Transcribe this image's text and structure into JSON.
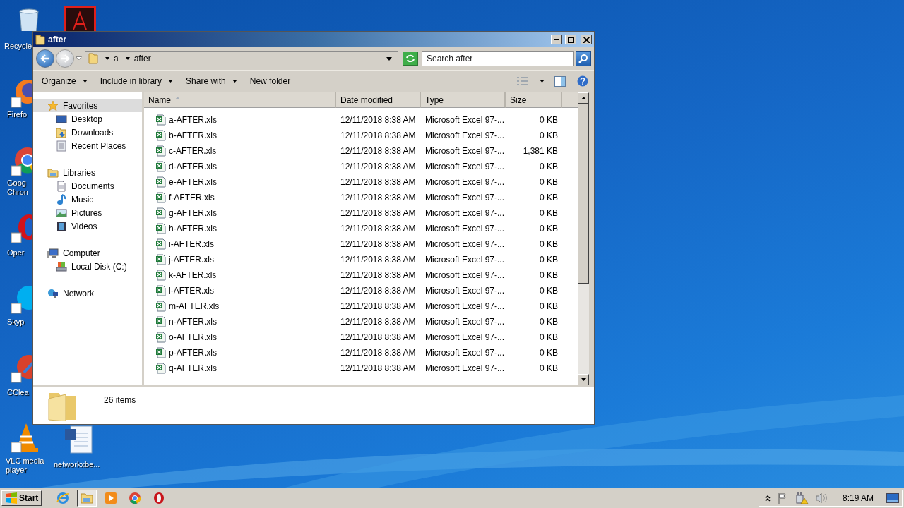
{
  "desktop_icons": [
    {
      "kind": "recycle",
      "lines": [
        "Recycle"
      ]
    },
    {
      "kind": "acrobat"
    },
    {
      "kind": "firefox",
      "lines": [
        "Firefo"
      ]
    },
    {
      "kind": "chrome",
      "lines": [
        "Goog",
        "Chron"
      ]
    },
    {
      "kind": "opera",
      "lines": [
        "Oper"
      ]
    },
    {
      "kind": "skype",
      "lines": [
        "Skyp"
      ]
    },
    {
      "kind": "ccleaner",
      "lines": [
        "CClea"
      ]
    },
    {
      "kind": "vlc",
      "lines": [
        "VLC media",
        "player"
      ]
    },
    {
      "kind": "word",
      "lines": [
        "networkxbe..."
      ]
    }
  ],
  "window": {
    "title": "after",
    "breadcrumb": [
      "a",
      "after"
    ],
    "search": {
      "placeholder": "Search after"
    },
    "commands": [
      {
        "label": "Organize",
        "dropdown": true
      },
      {
        "label": "Include in library",
        "dropdown": true
      },
      {
        "label": "Share with",
        "dropdown": true
      },
      {
        "label": "New folder",
        "dropdown": false
      }
    ],
    "nav": [
      {
        "label": "Favorites",
        "selected": true,
        "children": [
          {
            "label": "Desktop",
            "selected": false
          },
          {
            "label": "Downloads",
            "selected": false
          },
          {
            "label": "Recent Places",
            "selected": false
          }
        ]
      },
      {
        "label": "Libraries",
        "selected": false,
        "children": [
          {
            "label": "Documents",
            "selected": false
          },
          {
            "label": "Music",
            "selected": false
          },
          {
            "label": "Pictures",
            "selected": false
          },
          {
            "label": "Videos",
            "selected": false
          }
        ]
      },
      {
        "label": "Computer",
        "selected": false,
        "children": [
          {
            "label": "Local Disk (C:)",
            "selected": false
          }
        ]
      },
      {
        "label": "Network",
        "selected": false
      }
    ],
    "columns": [
      {
        "label": "Name",
        "sorted": true
      },
      {
        "label": "Date modified",
        "sorted": false
      },
      {
        "label": "Type",
        "sorted": false
      },
      {
        "label": "Size",
        "sorted": false
      }
    ],
    "rows": [
      {
        "name": "a-AFTER.xls",
        "date": "12/11/2018 8:38 AM",
        "type": "Microsoft Excel 97-...",
        "size": "0 KB"
      },
      {
        "name": "b-AFTER.xls",
        "date": "12/11/2018 8:38 AM",
        "type": "Microsoft Excel 97-...",
        "size": "0 KB"
      },
      {
        "name": "c-AFTER.xls",
        "date": "12/11/2018 8:38 AM",
        "type": "Microsoft Excel 97-...",
        "size": "1,381 KB"
      },
      {
        "name": "d-AFTER.xls",
        "date": "12/11/2018 8:38 AM",
        "type": "Microsoft Excel 97-...",
        "size": "0 KB"
      },
      {
        "name": "e-AFTER.xls",
        "date": "12/11/2018 8:38 AM",
        "type": "Microsoft Excel 97-...",
        "size": "0 KB"
      },
      {
        "name": "f-AFTER.xls",
        "date": "12/11/2018 8:38 AM",
        "type": "Microsoft Excel 97-...",
        "size": "0 KB"
      },
      {
        "name": "g-AFTER.xls",
        "date": "12/11/2018 8:38 AM",
        "type": "Microsoft Excel 97-...",
        "size": "0 KB"
      },
      {
        "name": "h-AFTER.xls",
        "date": "12/11/2018 8:38 AM",
        "type": "Microsoft Excel 97-...",
        "size": "0 KB"
      },
      {
        "name": "i-AFTER.xls",
        "date": "12/11/2018 8:38 AM",
        "type": "Microsoft Excel 97-...",
        "size": "0 KB"
      },
      {
        "name": "j-AFTER.xls",
        "date": "12/11/2018 8:38 AM",
        "type": "Microsoft Excel 97-...",
        "size": "0 KB"
      },
      {
        "name": "k-AFTER.xls",
        "date": "12/11/2018 8:38 AM",
        "type": "Microsoft Excel 97-...",
        "size": "0 KB"
      },
      {
        "name": "l-AFTER.xls",
        "date": "12/11/2018 8:38 AM",
        "type": "Microsoft Excel 97-...",
        "size": "0 KB"
      },
      {
        "name": "m-AFTER.xls",
        "date": "12/11/2018 8:38 AM",
        "type": "Microsoft Excel 97-...",
        "size": "0 KB"
      },
      {
        "name": "n-AFTER.xls",
        "date": "12/11/2018 8:38 AM",
        "type": "Microsoft Excel 97-...",
        "size": "0 KB"
      },
      {
        "name": "o-AFTER.xls",
        "date": "12/11/2018 8:38 AM",
        "type": "Microsoft Excel 97-...",
        "size": "0 KB"
      },
      {
        "name": "p-AFTER.xls",
        "date": "12/11/2018 8:38 AM",
        "type": "Microsoft Excel 97-...",
        "size": "0 KB"
      },
      {
        "name": "q-AFTER.xls",
        "date": "12/11/2018 8:38 AM",
        "type": "Microsoft Excel 97-...",
        "size": "0 KB"
      }
    ],
    "details": {
      "count": "26 items"
    }
  },
  "taskbar": {
    "start": "Start",
    "apps": [
      {
        "kind": "ie",
        "selected": false
      },
      {
        "kind": "explorer",
        "selected": true
      },
      {
        "kind": "media",
        "selected": false
      },
      {
        "kind": "chrome",
        "selected": false
      },
      {
        "kind": "opera",
        "selected": false
      }
    ],
    "clock": "8:19 AM"
  }
}
